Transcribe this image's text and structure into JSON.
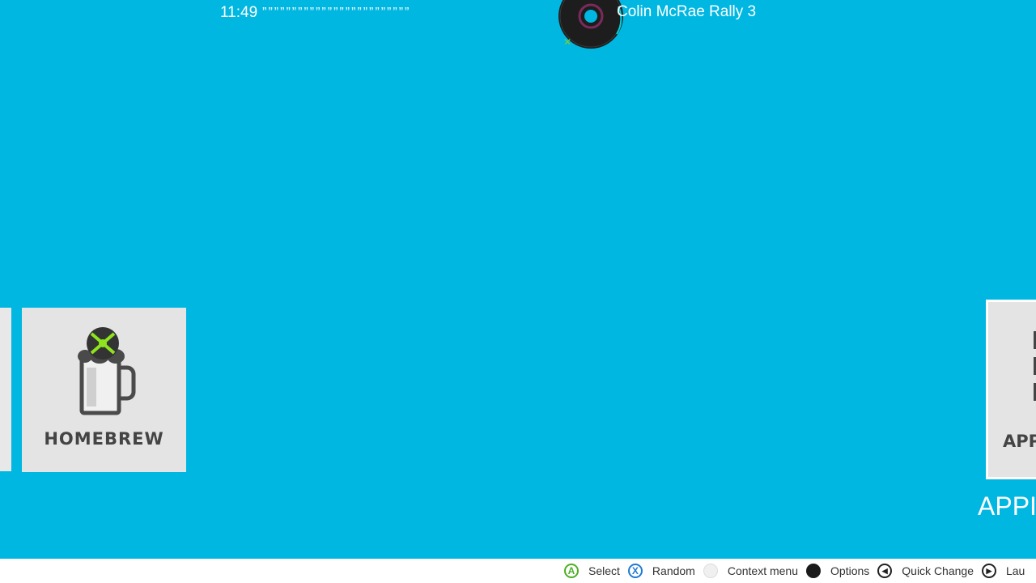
{
  "header": {
    "time": "11:49",
    "scroll_dots": "”””””””””””””””””””””””””",
    "game_title": "Colin McRae Rally 3",
    "disc_icon": "game-disc-icon"
  },
  "tiles": [
    {
      "name": "partial-tile-left",
      "label": ""
    },
    {
      "name": "homebrew",
      "label": "HOMEBREW",
      "icon": "beer-mug-xbox-icon"
    },
    {
      "name": "apps",
      "label": "APP"
    }
  ],
  "section": {
    "label": "APPI"
  },
  "hints": [
    {
      "button": "A",
      "label": "Select",
      "icon": "a-button-icon"
    },
    {
      "button": "X",
      "label": "Random",
      "icon": "x-button-icon"
    },
    {
      "button": "",
      "label": "Context menu",
      "icon": "white-button-icon"
    },
    {
      "button": "",
      "label": "Options",
      "icon": "black-button-icon"
    },
    {
      "button": "◀",
      "label": "Quick Change",
      "icon": "dpad-left-icon"
    },
    {
      "button": "▶",
      "label": "Lau",
      "icon": "dpad-right-icon"
    }
  ],
  "colors": {
    "background": "#00b7e2",
    "tile": "#e4e4e4",
    "a_green": "#4caf24",
    "x_blue": "#1f7ad6"
  }
}
